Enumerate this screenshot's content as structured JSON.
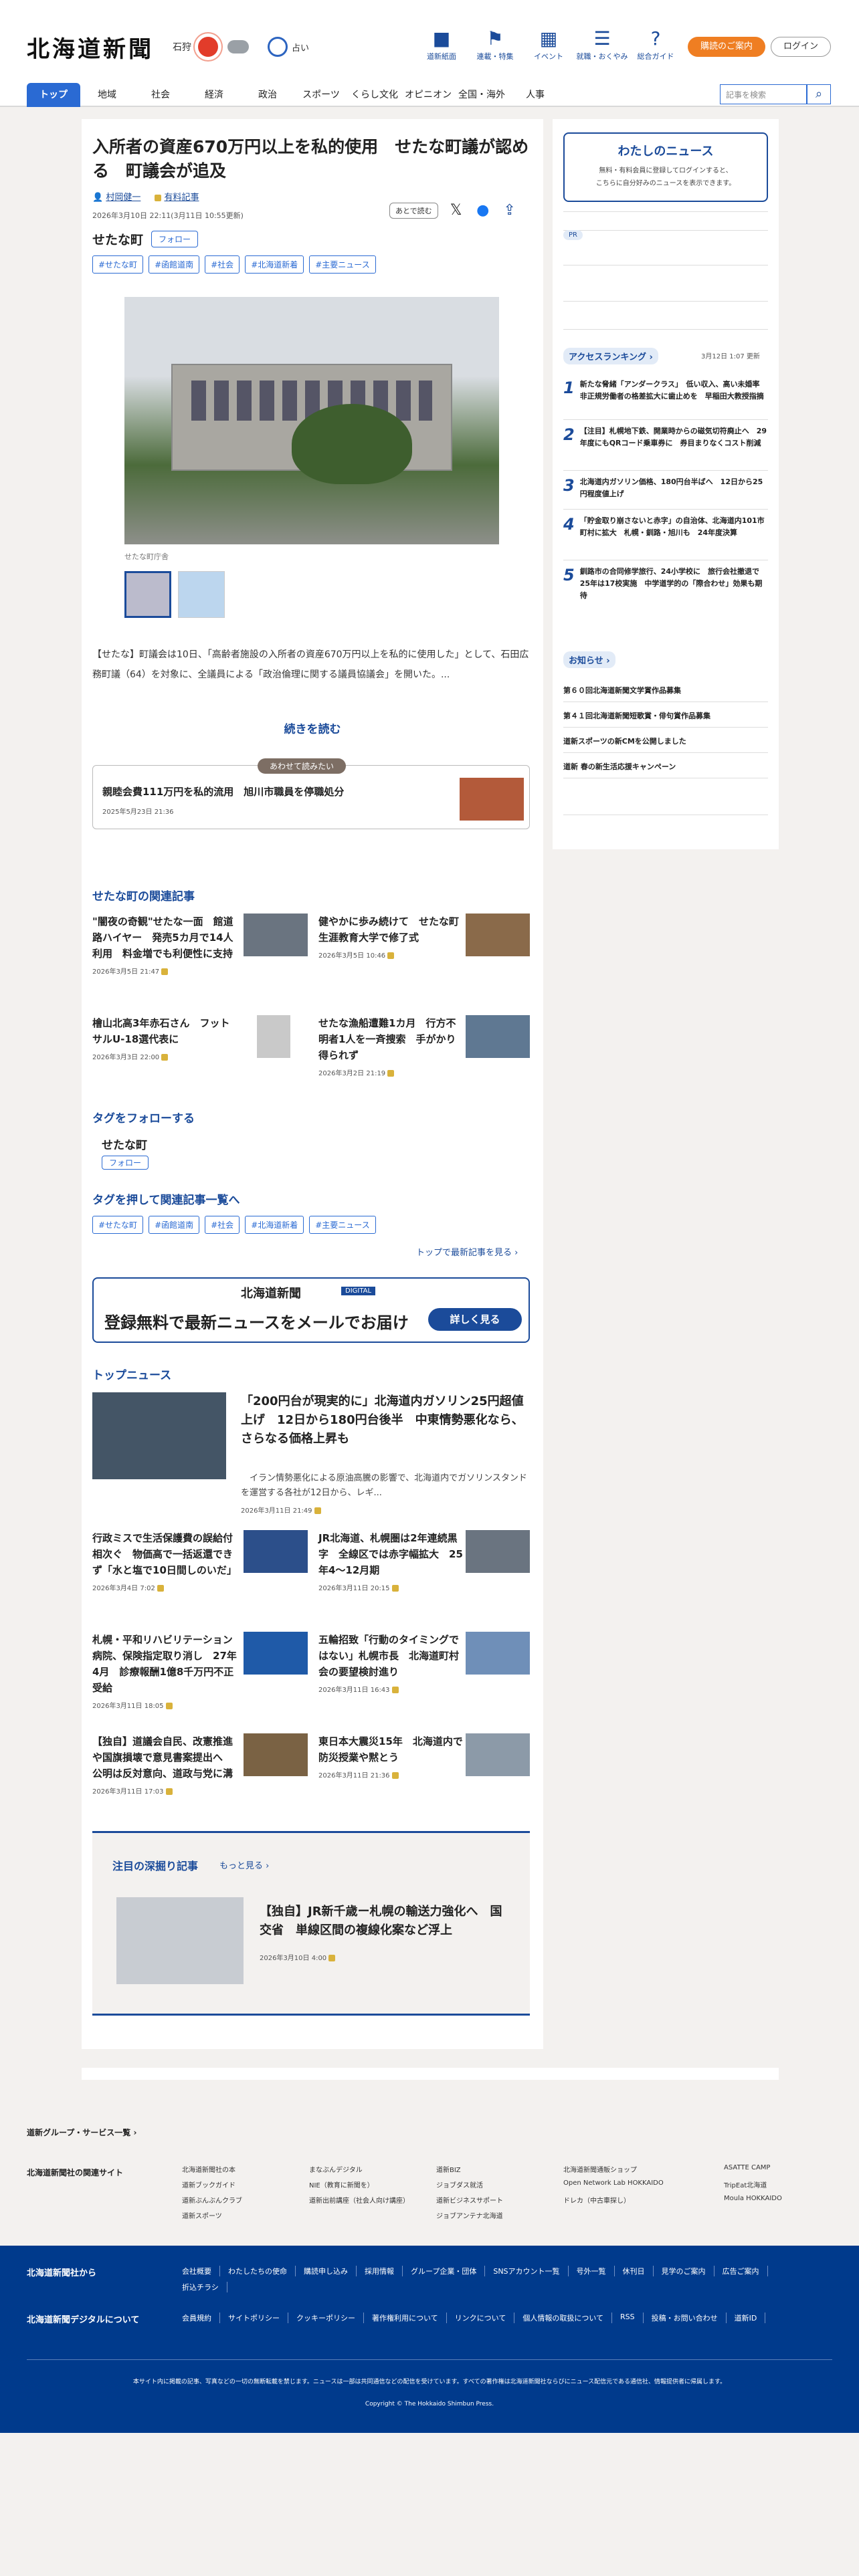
{
  "header": {
    "logo": "北海道新聞",
    "weather_city": "石狩",
    "fortune_label": "占い",
    "nav_icons": [
      {
        "label": "道新紙面",
        "icon": "newspaper-icon"
      },
      {
        "label": "連載・特集",
        "icon": "flag-icon"
      },
      {
        "label": "イベント",
        "icon": "calendar-icon"
      },
      {
        "label": "就職・おくやみ",
        "icon": "list-icon"
      },
      {
        "label": "総合ガイド",
        "icon": "question-icon"
      }
    ],
    "subscribe": "購読のご案内",
    "login": "ログイン",
    "categories": [
      "トップ",
      "地域",
      "社会",
      "経済",
      "政治",
      "スポーツ",
      "くらし文化",
      "オピニオン",
      "全国・海外",
      "人事"
    ],
    "search_placeholder": "記事を検索"
  },
  "article": {
    "title": "入所者の資産670万円以上を私的使用　せたな町議が認める　町議会が追及",
    "author": "村岡健一",
    "badge": "有料記事",
    "date": "2026年3月10日 22:11(3月11日 10:55更新)",
    "later": "あとで読む",
    "tag_name": "せたな町",
    "follow": "フォロー",
    "tags": [
      "#せたな町",
      "#函館道南",
      "#社会",
      "#北海道新着",
      "#主要ニュース"
    ],
    "caption": "せたな町庁舎",
    "body": "【せたな】町議会は10日、「高齢者施設の入所者の資産670万円以上を私的に使用した」として、石田広務町議（64）を対象に、全議員による「政治倫理に関する議員協議会」を開いた。...",
    "read_more": "続きを読む",
    "related_badge": "あわせて読みたい",
    "related_title": "親睦会費111万円を私的流用　旭川市職員を停職処分",
    "related_date": "2025年5月23日 21:36"
  },
  "local": {
    "title": "せたな町の関連記事",
    "items": [
      {
        "title": "\"闇夜の奇観\"せたな一面　館道路ハイヤー　発売5カ月で14人利用　料金増でも利便性に支持",
        "date": "2026年3月5日 21:47"
      },
      {
        "title": "健やかに歩み続けて　せたな町生涯教育大学で修了式",
        "date": "2026年3月5日 10:46"
      },
      {
        "title": "檜山北高3年赤石さん　フットサルU-18選代表に",
        "date": "2026年3月3日 22:00"
      },
      {
        "title": "せたな漁船遭難1カ月　行方不明者1人を一斉捜索　手がかり得られず",
        "date": "2026年3月2日 21:19"
      }
    ]
  },
  "follow_tag": {
    "title": "タグをフォローする",
    "tag": "せたな町",
    "follow": "フォロー"
  },
  "tag_list": {
    "title": "タグを押して関連記事一覧へ",
    "tags": [
      "#せたな町",
      "#函館道南",
      "#社会",
      "#北海道新着",
      "#主要ニュース"
    ],
    "top_link": "トップで最新記事を見る"
  },
  "promo": {
    "brand": "北海道新聞",
    "digital": "DIGITAL",
    "headline": "登録無料で最新ニュースをメールでお届け",
    "cta": "詳しく見る"
  },
  "top_news": {
    "title": "トップニュース",
    "lead_title": "「200円台が現実的に」北海道内ガソリン25円超値上げ　12日から180円台後半　中東情勢悪化なら、さらなる価格上昇も",
    "lead_body": "　イラン情勢悪化による原油高騰の影響で、北海道内でガソリンスタンドを運営する各社が12日から、レギ...",
    "lead_date": "2026年3月11日 21:49",
    "items": [
      {
        "title": "行政ミスで生活保護費の誤給付相次ぐ　物価高で一括返還できず「水と塩で10日間しのいだ」",
        "date": "2026年3月4日 7:02"
      },
      {
        "title": "JR北海道、札幌圏は2年連続黒字　全線区では赤字幅拡大　25年4〜12月期",
        "date": "2026年3月11日 20:15"
      },
      {
        "title": "札幌・平和リハビリテーション病院、保険指定取り消し　27年4月　診療報酬1億8千万円不正受給",
        "date": "2026年3月11日 18:05"
      },
      {
        "title": "五輪招致「行動のタイミングではない」札幌市長　北海道町村会の要望検討進り",
        "date": "2026年3月11日 16:43"
      },
      {
        "title": "【独自】道議会自民、改憲推進や国旗損壊で意見書案提出へ　公明は反対意向、道政与党に溝",
        "date": "2026年3月11日 17:03"
      },
      {
        "title": "東日本大震災15年　北海道内で防災授業や黙とう",
        "date": "2026年3月11日 21:36"
      }
    ]
  },
  "deep": {
    "title": "注目の深掘り記事",
    "more": "もっと見る",
    "item_title": "【独自】JR新千歳ー札幌の輸送力強化へ　国交省　単線区間の複線化案など浮上",
    "item_date": "2026年3月10日 4:00"
  },
  "sidebar": {
    "my_news": "わたしのニュース",
    "my_news_desc1": "無料・有料会員に登録してログインすると、",
    "my_news_desc1_link": "ログイン",
    "my_news_desc2": "こちらに自分好みのニュースを表示できます。",
    "pr": "PR",
    "ranking_title": "アクセスランキング",
    "ranking_updated": "3月12日 1:07 更新",
    "ranking": [
      {
        "rank": "1",
        "title": "新たな脅緒「アンダークラス」　低い収入、高い未婚率　非正規労働者の格差拡大に歯止めを　早稲田大教授指摘"
      },
      {
        "rank": "2",
        "title": "【注目】札幌地下鉄、開業時からの磁気切符廃止へ　29年度にもQRコード乗車券に　券目まりなくコスト削減"
      },
      {
        "rank": "3",
        "title": "北海道内ガソリン価格、180円台半ばへ　12日から25円程度値上げ"
      },
      {
        "rank": "4",
        "title": "「貯金取り崩さないと赤字」の自治体、北海道内101市町村に拡大　札幌・釧路・旭川も　24年度決算"
      },
      {
        "rank": "5",
        "title": "釧路市の合同修学旅行、24小学校に　旅行会社撤退で25年は17校実施　中学道学的の「際合わせ」効果も期待"
      }
    ],
    "notice_title": "お知らせ",
    "notices": [
      "第６０回北海道新聞文学賞作品募集",
      "第４１回北海道新聞短歌賞・俳句賞作品募集",
      "道新スポーツの新CMを公開しました",
      "道新 春の新生活応援キャンペーン"
    ]
  },
  "footer": {
    "group_link": "道新グループ・サービス一覧",
    "related_sites_label": "北海道新聞社の関連サイト",
    "sites": [
      "北海道新聞社の本",
      "まなぶんデジタル",
      "道新BIZ",
      "北海道新聞通販ショップ",
      "ASATTE CAMP",
      "道新ブックガイド",
      "NIE（教育に新聞を）",
      "ジョブダス就活",
      "Open Network Lab HOKKAIDO",
      "TripEat北海道",
      "道新ぶんぶんクラブ",
      "道新出前講座（社会人向け講座）",
      "道新ビジネスサポート",
      "ドレカ（中古車探し）",
      "Moula HOKKAIDO",
      "道新スポーツ",
      "",
      "ジョブアンテナ北海道",
      "",
      ""
    ],
    "from_label": "北海道新聞社から",
    "from_links": [
      "会社概要",
      "わたしたちの使命",
      "購読申し込み",
      "採用情報",
      "グループ企業・団体",
      "SNSアカウント一覧",
      "号外一覧",
      "休刊日",
      "見学のご案内",
      "広告ご案内",
      "折込チラシ"
    ],
    "digital_label": "北海道新聞デジタルについて",
    "digital_links": [
      "会員規約",
      "サイトポリシー",
      "クッキーポリシー",
      "著作権利用について",
      "リンクについて",
      "個人情報の取扱について",
      "RSS",
      "投稿・お問い合わせ",
      "道新ID"
    ],
    "notice": "本サイト内に掲載の記事、写真などの一切の無断転載を禁じます。ニュースは一部は共同通信などの配信を受けています。すべての著作権は北海道新聞社ならびにニュース配信元である通信社、情報提供者に帰属します。",
    "copyright": "Copyright © The Hokkaido Shimbun Press."
  }
}
